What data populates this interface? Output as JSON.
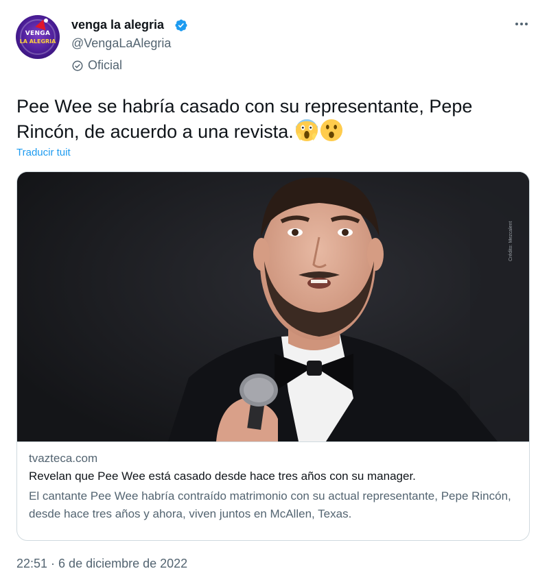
{
  "author": {
    "avatar_text_top": "VENGA",
    "avatar_text_bottom": "LA ALEGRIA",
    "name": "venga la alegria",
    "handle": "@VengaLaAlegria",
    "label": "Oficial",
    "verified_icon": "verified-badge-icon",
    "more_icon": "more-options-icon"
  },
  "tweet": {
    "text": "Pee Wee se habría casado con su representante, Pepe Rincón, de acuerdo a una revista.",
    "emojis": [
      "😱",
      "😮"
    ],
    "translate_label": "Traducir tuit",
    "timestamp": "22:51 · 6 de diciembre de 2022"
  },
  "card": {
    "image_credit": "Crédito: Mezcalent",
    "domain": "tvazteca.com",
    "title": "Revelan que Pee Wee está casado desde hace tres años con su manager.",
    "description": "El cantante Pee Wee habría contraído matrimonio con su actual representante, Pepe Rincón, desde hace tres años y ahora, viven juntos en McAllen, Texas."
  },
  "colors": {
    "accent": "#1d9bf0",
    "secondary_text": "#536471",
    "primary_text": "#0f1419",
    "border": "#cfd9de"
  }
}
